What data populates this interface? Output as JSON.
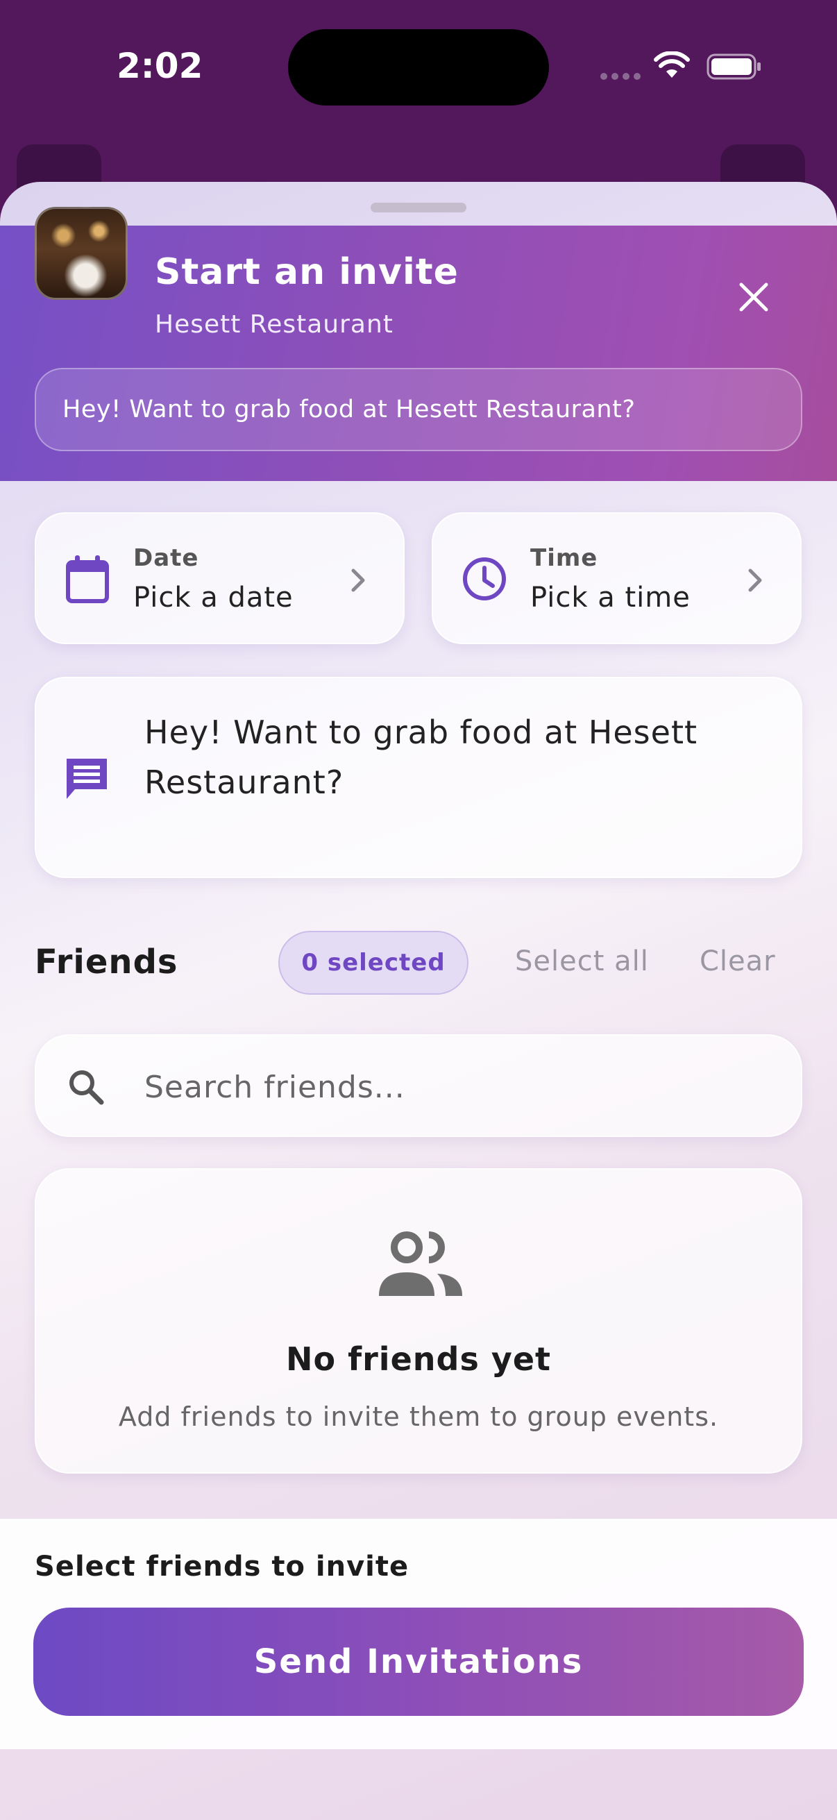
{
  "status_bar": {
    "time": "2:02"
  },
  "sheet": {
    "header": {
      "title": "Start an invite",
      "venue": "Hesett Restaurant",
      "message_preview": "Hey! Want to grab food at Hesett Restaurant?"
    },
    "date": {
      "label": "Date",
      "value": "Pick a date",
      "icon": "calendar-icon"
    },
    "time": {
      "label": "Time",
      "value": "Pick a time",
      "icon": "clock-icon"
    },
    "message": {
      "text": "Hey! Want to grab food at Hesett Restaurant?",
      "icon": "message-icon"
    },
    "friends": {
      "title": "Friends",
      "selected_badge": "0 selected",
      "select_all": "Select all",
      "clear": "Clear",
      "search_placeholder": "Search friends...",
      "empty_title": "No friends yet",
      "empty_subtitle": "Add friends to invite them to group events."
    },
    "footer": {
      "hint": "Select friends to invite",
      "send_label": "Send Invitations"
    }
  },
  "colors": {
    "accent": "#6f47c2",
    "header_gradient_start": "#7650c6",
    "header_gradient_end": "#a64d9e",
    "backdrop": "#53175c"
  }
}
